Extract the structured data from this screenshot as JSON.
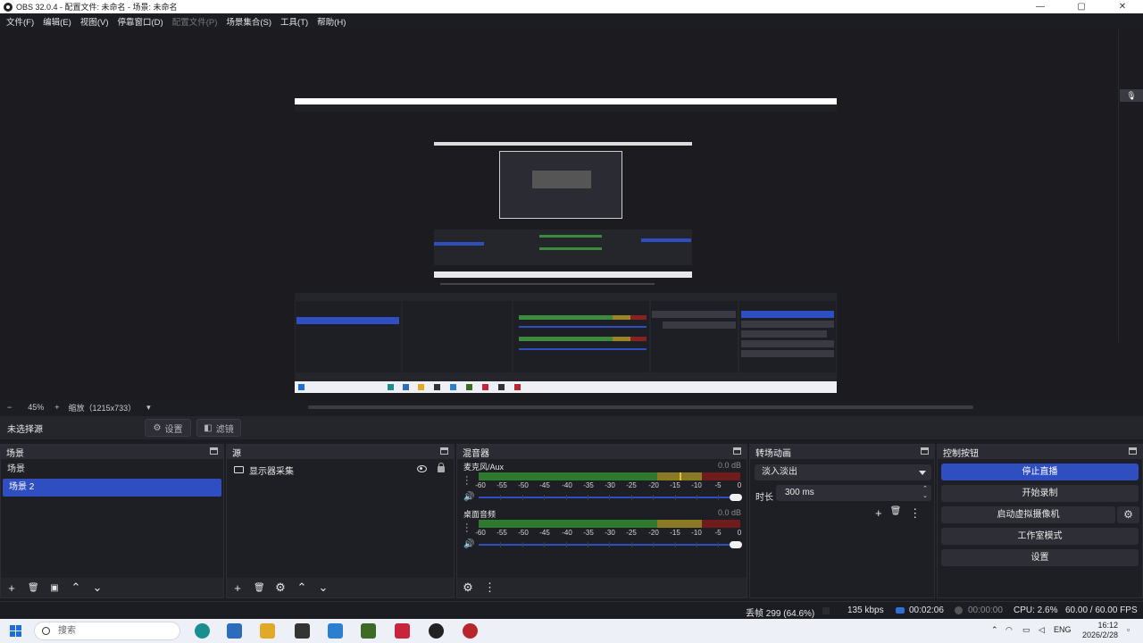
{
  "window": {
    "title": "OBS 32.0.4 - 配置文件: 未命名 - 场景: 未命名",
    "buttons": {
      "minimize": "—",
      "maximize": "▢",
      "close": "✕"
    }
  },
  "menu": {
    "items": [
      "文件(F)",
      "编辑(E)",
      "视图(V)",
      "停靠窗口(D)",
      "配置文件(P)",
      "场景集合(S)",
      "工具(T)",
      "帮助(H)"
    ]
  },
  "zoom": {
    "minus": "−",
    "level": "45%",
    "plus": "+",
    "scale_label": "缩放（1215x733）",
    "dropdown": "▾"
  },
  "source_bar": {
    "no_source": "未选择源",
    "settings": "设置",
    "filters": "滤镜"
  },
  "scenes": {
    "title": "场景",
    "items": [
      {
        "label": "场景",
        "selected": false
      },
      {
        "label": "场景 2",
        "selected": true
      }
    ],
    "tools": [
      "+",
      "🗑",
      "▣",
      "⌃",
      "⌄"
    ]
  },
  "sources": {
    "title": "源",
    "items": [
      {
        "label": "显示器采集",
        "type": "display-capture"
      }
    ],
    "tools": [
      "+",
      "🗑",
      "⚙",
      "⌃",
      "⌄"
    ]
  },
  "mixer": {
    "title": "混音器",
    "ticks": [
      "-60",
      "-55",
      "-50",
      "-45",
      "-40",
      "-35",
      "-30",
      "-25",
      "-20",
      "-15",
      "-10",
      "-5",
      "0"
    ],
    "channels": [
      {
        "name": "麦克风/Aux",
        "db": "0.0 dB",
        "peak_level": 0.77,
        "volume": 1.0
      },
      {
        "name": "桌面音频",
        "db": "0.0 dB",
        "peak_level": 0.0,
        "volume": 1.0
      }
    ],
    "tools": [
      "⚙",
      "⋮"
    ]
  },
  "transitions": {
    "title": "转场动画",
    "selected": "淡入淡出",
    "duration_label": "时长",
    "duration_value": "300 ms",
    "tools": [
      "+",
      "🗑",
      "⋮"
    ]
  },
  "controls": {
    "title": "控制按钮",
    "stop_stream": "停止直播",
    "start_record": "开始录制",
    "virtual_cam": "启动虚拟摄像机",
    "studio_mode": "工作室模式",
    "settings": "设置"
  },
  "status": {
    "dropped": "丢帧 299 (64.6%)",
    "bitrate": "135 kbps",
    "stream_time": "00:02:06",
    "record_time": "00:00:00",
    "cpu": "CPU: 2.6%",
    "fps": "60.00 / 60.00 FPS"
  },
  "taskbar": {
    "search_placeholder": "搜索",
    "lang": "ENG",
    "time": "16:12",
    "date": "2026/2/28"
  },
  "colors": {
    "accent": "#2f4ec0",
    "meter_green": "#2f7a2f",
    "meter_yellow": "#8a7a23",
    "meter_red": "#6f1c1c",
    "live_dot": "#2f6fd8"
  }
}
